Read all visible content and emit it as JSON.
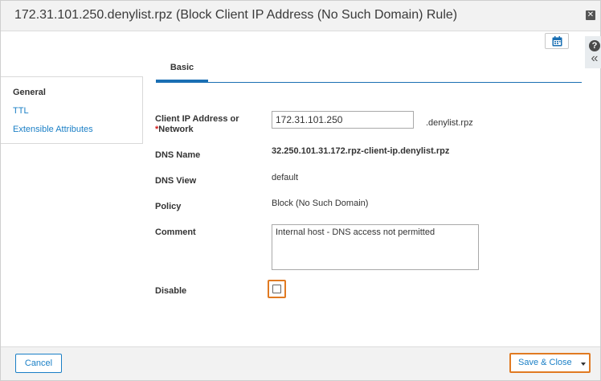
{
  "window": {
    "title": "172.31.101.250.denylist.rpz (Block Client IP Address (No Such Domain) Rule)",
    "close_glyph": "✕"
  },
  "help": {
    "help_glyph": "?",
    "collapse_glyph": "«"
  },
  "toolbar": {
    "calendar_icon": "calendar-icon"
  },
  "sidebar": {
    "items": [
      {
        "label": "General",
        "active": true
      },
      {
        "label": "TTL",
        "active": false
      },
      {
        "label": "Extensible Attributes",
        "active": false
      }
    ]
  },
  "tabs": [
    {
      "label": "Basic",
      "active": true
    }
  ],
  "form": {
    "client_ip": {
      "label_line1": "Client IP Address or",
      "label_req": "*",
      "label_line2": "Network",
      "value": "172.31.101.250",
      "suffix": ".denylist.rpz"
    },
    "dns_name": {
      "label": "DNS Name",
      "value": "32.250.101.31.172.rpz-client-ip.denylist.rpz"
    },
    "dns_view": {
      "label": "DNS View",
      "value": "default"
    },
    "policy": {
      "label": "Policy",
      "value": "Block (No Such Domain)"
    },
    "comment": {
      "label": "Comment",
      "value": "Internal host - DNS access not permitted"
    },
    "disable": {
      "label": "Disable",
      "checked": false
    }
  },
  "footer": {
    "cancel_label": "Cancel",
    "save_label": "Save & Close"
  },
  "colors": {
    "link": "#1a7fc6",
    "tab_accent": "#1a6fb3",
    "highlight": "#e07a22",
    "required": "#d01a1a"
  }
}
